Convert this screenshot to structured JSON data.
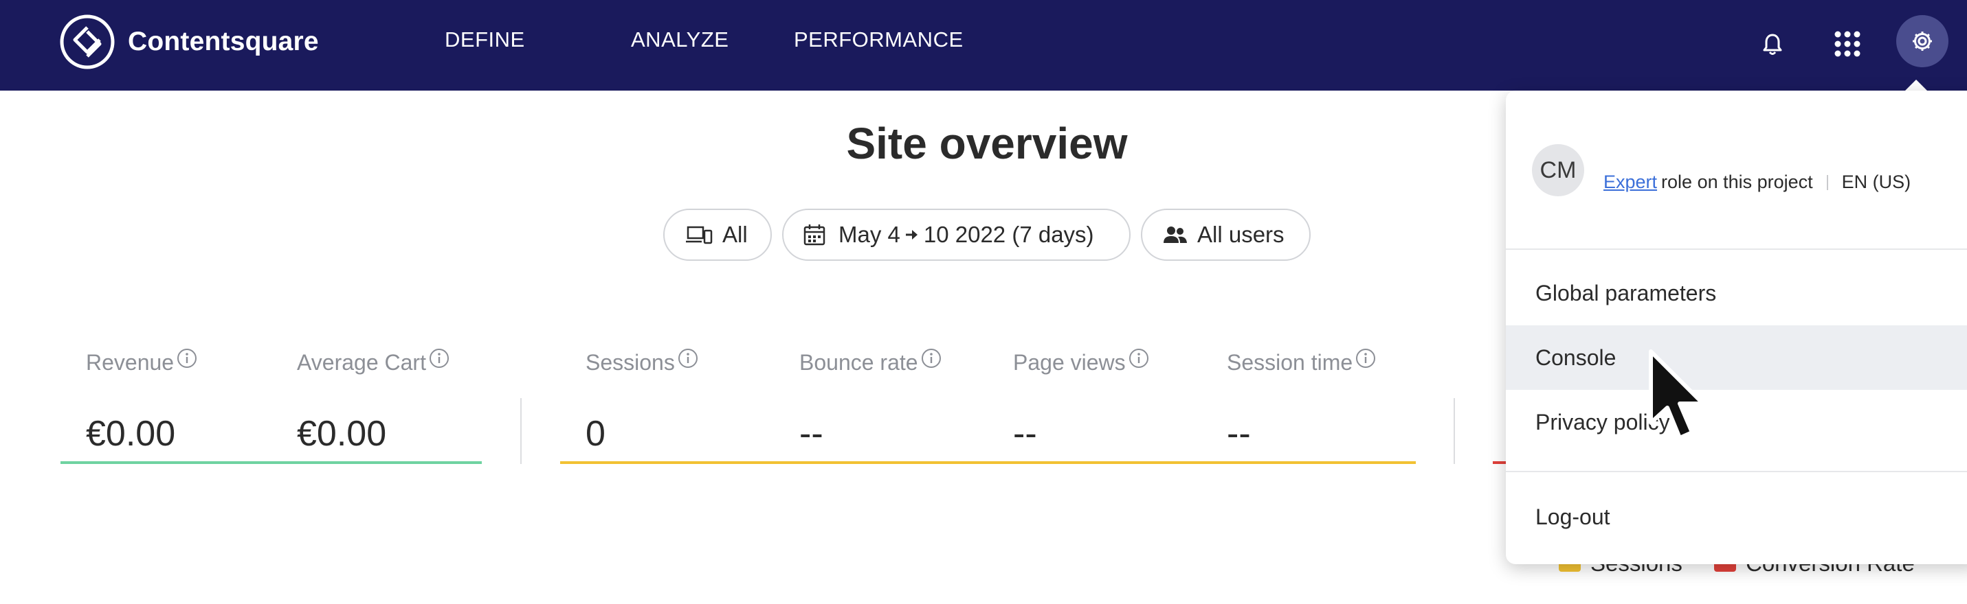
{
  "brand": {
    "name": "Contentsquare"
  },
  "nav": {
    "items": [
      {
        "label": "DEFINE"
      },
      {
        "label": "ANALYZE"
      },
      {
        "label": "PERFORMANCE"
      }
    ]
  },
  "header_icons": [
    "bell-icon",
    "apps-grid-icon",
    "gear-icon"
  ],
  "page": {
    "title": "Site overview"
  },
  "filters": {
    "device": "All",
    "date_start": "May 4",
    "date_end": "10 2022 (7 days)",
    "segment": "All users"
  },
  "metrics": [
    {
      "label": "Revenue",
      "value": "€0.00"
    },
    {
      "label": "Average Cart",
      "value": "€0.00"
    },
    {
      "label": "Sessions",
      "value": "0"
    },
    {
      "label": "Bounce rate",
      "value": "--"
    },
    {
      "label": "Page views",
      "value": "--"
    },
    {
      "label": "Session time",
      "value": "--"
    }
  ],
  "colors": {
    "nav_bg": "#1a1a5c",
    "revenue_accent": "#6fd3a1",
    "sessions_accent": "#f2c233",
    "conversion_accent": "#e0413a",
    "link": "#3b6fd9"
  },
  "account_menu": {
    "avatar_initials": "CM",
    "user_name": "",
    "role_link": "Expert",
    "role_suffix": "role on this project",
    "language": "EN (US)",
    "items": [
      {
        "label": "Global parameters"
      },
      {
        "label": "Console",
        "hovered": true
      },
      {
        "label": "Privacy policy"
      },
      {
        "label": "Log-out"
      }
    ]
  },
  "chart_legend": [
    {
      "label": "Sessions",
      "color": "#f2c233"
    },
    {
      "label": "Conversion Rate",
      "color": "#e0413a"
    }
  ]
}
